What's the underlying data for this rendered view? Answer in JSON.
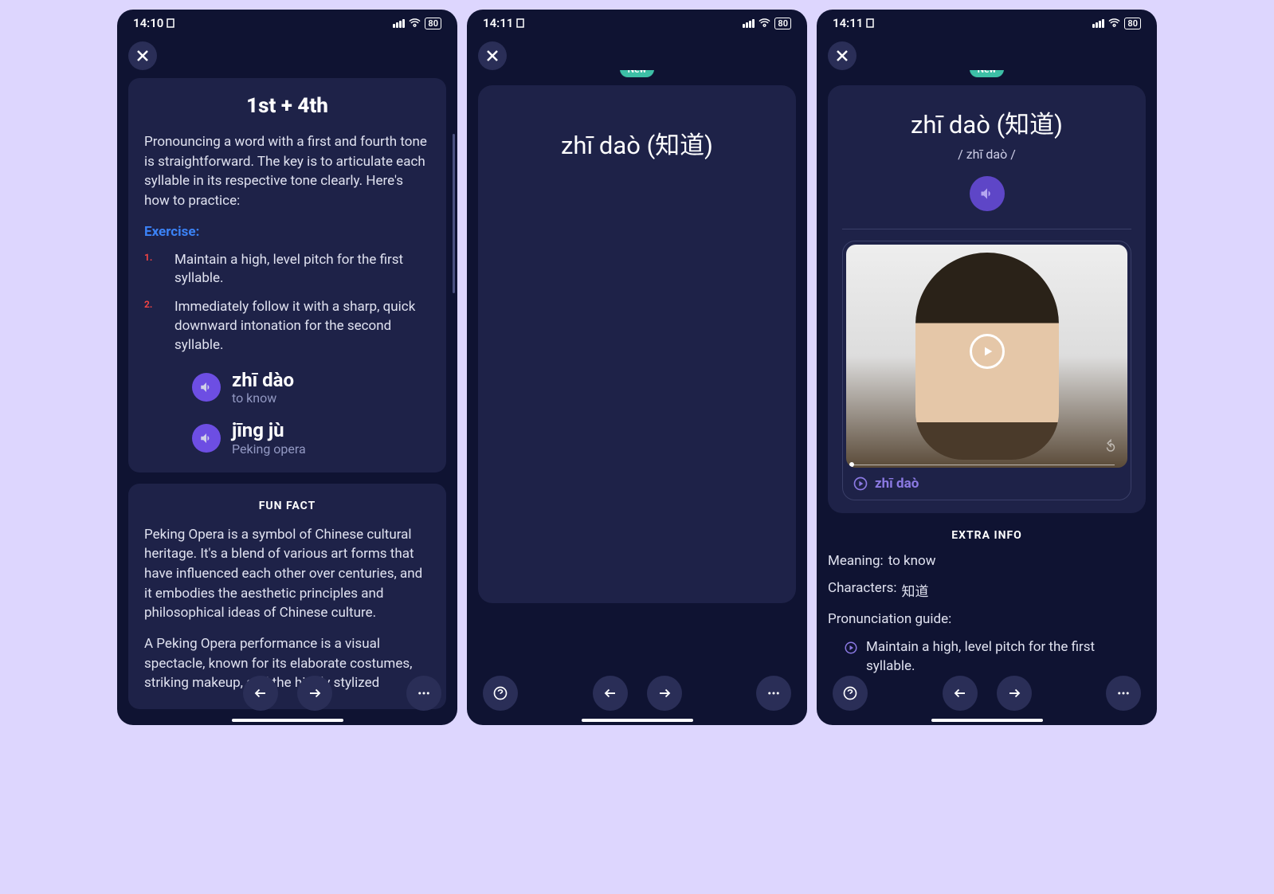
{
  "phone1": {
    "time": "14:10",
    "battery": "80",
    "card_title": "1st + 4th",
    "intro": "Pronouncing a word with a first and fourth tone is straightforward. The key is to articulate each syllable in its respective tone clearly. Here's how to practice:",
    "exercise_label": "Exercise:",
    "step1": "Maintain a high, level pitch for the first syllable.",
    "step2": "Immediately follow it with a sharp, quick downward intonation for the second syllable.",
    "word1_pinyin": "zhī dào",
    "word1_meaning": "to know",
    "word2_pinyin": "jīng jù",
    "word2_meaning": "Peking opera",
    "fun_fact_label": "FUN FACT",
    "fun_fact_p1": "Peking Opera is a symbol of Chinese cultural heritage. It's a blend of various art forms that have influenced each other over centuries, and it embodies the aesthetic principles and philosophical ideas of Chinese culture.",
    "fun_fact_p2": "A Peking Opera performance is a visual spectacle, known for its elaborate costumes, striking makeup, and the highly stylized"
  },
  "phone2": {
    "time": "14:11",
    "battery": "80",
    "badge": "New",
    "word": "zhī daò (知道)"
  },
  "phone3": {
    "time": "14:11",
    "battery": "80",
    "badge": "New",
    "title": "zhī daò (知道)",
    "subtitle": "/ zhī daò /",
    "caption": "zhī daò",
    "extra_title": "EXTRA INFO",
    "meaning_label": "Meaning:",
    "meaning_value": "to know",
    "chars_label": "Characters:",
    "chars_value": "知道",
    "guide_label": "Pronunciation guide:",
    "guide_item": "Maintain a high, level pitch for the first syllable."
  }
}
